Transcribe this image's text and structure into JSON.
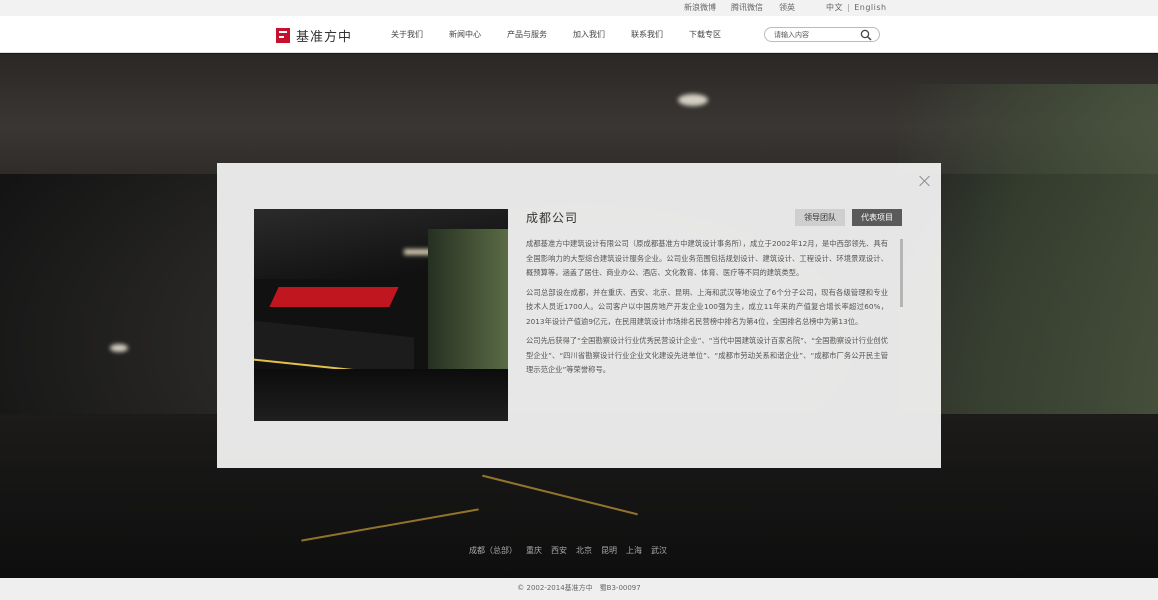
{
  "topbar": {
    "links": [
      "新浪微博",
      "腾讯微信",
      "领英"
    ],
    "lang_cn": "中文",
    "lang_sep": "|",
    "lang_en": "English"
  },
  "header": {
    "logo_text": "基准方中",
    "nav": [
      "关于我们",
      "新闻中心",
      "产品与服务",
      "加入我们",
      "联系我们",
      "下载专区"
    ],
    "search_placeholder": "请输入内容"
  },
  "modal": {
    "title": "成都公司",
    "tab_team": "领导团队",
    "tab_projects": "代表项目",
    "paragraphs": [
      "成都基准方中建筑设计有限公司（原成都基准方中建筑设计事务所），成立于2002年12月，是中西部领先、具有全国影响力的大型综合建筑设计服务企业。公司业务范围包括规划设计、建筑设计、工程设计、环境景观设计、概预算等，涵盖了居住、商业办公、酒店、文化教育、体育、医疗等不同的建筑类型。",
      "公司总部设在成都，并在重庆、西安、北京、昆明、上海和武汉等地设立了6个分子公司，现有各级管理和专业技术人员近1700人。公司客户以中国房地产开发企业100强为主，成立11年来的产值复合增长率超过60%，2013年设计产值逾9亿元，在民用建筑设计市场排名民营榜中排名为第4位，全国排名总榜中为第13位。",
      "公司先后获得了“全国勘察设计行业优秀民营设计企业”、“当代中国建筑设计百家名院”、“全国勘察设计行业创优型企业”、“四川省勘察设计行业企业文化建设先进单位”、“成都市劳动关系和谐企业”、“成都市厂务公开民主管理示范企业”等荣誉称号。"
    ]
  },
  "cities": [
    "成都（总部）",
    "重庆",
    "西安",
    "北京",
    "昆明",
    "上海",
    "武汉"
  ],
  "footer": {
    "copyright": "© 2002-2014基准方中　蜀B3-00097"
  }
}
